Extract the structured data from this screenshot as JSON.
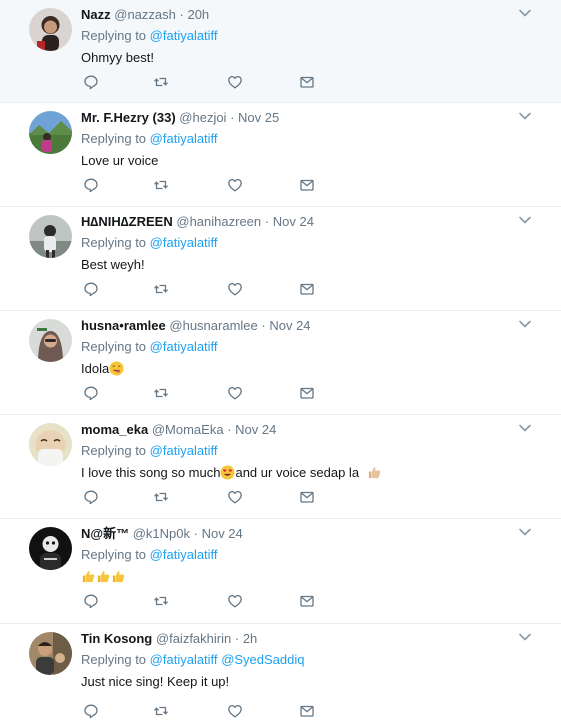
{
  "replying_prefix": "Replying to",
  "dot": "·",
  "tweets": [
    {
      "name": "Nazz",
      "handle": "@nazzash",
      "time": "20h",
      "mentions": [
        "@fatiyalatiff"
      ],
      "text": "Ohmyy best!"
    },
    {
      "name": "Mr. F.Hezry (33)",
      "handle": "@hezjoi",
      "time": "Nov 25",
      "mentions": [
        "@fatiyalatiff"
      ],
      "text": "Love ur voice"
    },
    {
      "name": "H∆NIH∆ZREEN",
      "handle": "@hanihazreen",
      "time": "Nov 24",
      "mentions": [
        "@fatiyalatiff"
      ],
      "text": "Best weyh!"
    },
    {
      "name": "husna•ramlee",
      "handle": "@husnaramlee",
      "time": "Nov 24",
      "mentions": [
        "@fatiyalatiff"
      ],
      "text": "Idola"
    },
    {
      "name": "moma_eka",
      "handle": "@MomaEka",
      "time": "Nov 24",
      "mentions": [
        "@fatiyalatiff"
      ],
      "text_a": "I love this song so much",
      "text_b": "and ur voice sedap la"
    },
    {
      "name": "N@新™",
      "handle": "@k1Np0k",
      "time": "Nov 24",
      "mentions": [
        "@fatiyalatiff"
      ],
      "text": ""
    },
    {
      "name": "Tin Kosong",
      "handle": "@faizfakhirin",
      "time": "2h",
      "mentions": [
        "@fatiyalatiff",
        "@SyedSaddiq"
      ],
      "text": "Just nice sing! Keep it up!"
    }
  ],
  "icons": {
    "reply": "reply-icon",
    "retweet": "retweet-icon",
    "like": "heart-icon",
    "message": "envelope-icon",
    "menu": "chevron-down-icon"
  },
  "colors": {
    "link": "#1da1f2",
    "muted": "#657786",
    "text": "#14171a",
    "highlight_bg": "#f5f8fa",
    "divider": "#e6ecf0"
  }
}
